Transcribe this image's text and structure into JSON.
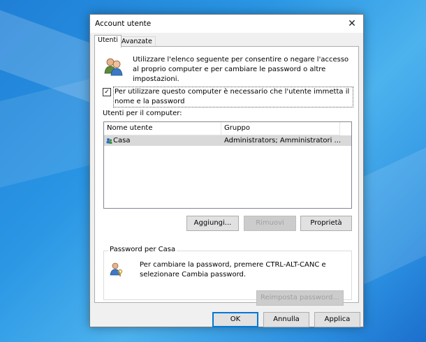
{
  "window": {
    "title": "Account utente"
  },
  "tabs": [
    {
      "label": "Utenti"
    },
    {
      "label": "Avanzate"
    }
  ],
  "users_tab": {
    "intro_text": "Utilizzare l'elenco seguente per consentire o negare l'accesso al proprio computer e per cambiare le password o altre impostazioni.",
    "require_password_checkbox": {
      "checked": true,
      "label": "Per utilizzare questo computer è necessario che l'utente immetta il nome e la password"
    },
    "users_list_label": "Utenti per il computer:",
    "columns": [
      "Nome utente",
      "Gruppo"
    ],
    "rows": [
      {
        "username": "Casa",
        "group": "Administrators; Amministratori ..."
      }
    ],
    "buttons": {
      "add": "Aggiungi...",
      "remove": "Rimuovi",
      "properties": "Proprietà"
    },
    "password_group": {
      "legend": "Password per Casa",
      "text": "Per cambiare la password, premere CTRL-ALT-CANC e selezionare Cambia password.",
      "reset_button": "Reimposta password..."
    }
  },
  "footer": {
    "ok": "OK",
    "cancel": "Annulla",
    "apply": "Applica"
  },
  "colors": {
    "desktop": "#2a96e4",
    "focus_border": "#0078d7",
    "selected_row": "#d9d9d9"
  }
}
